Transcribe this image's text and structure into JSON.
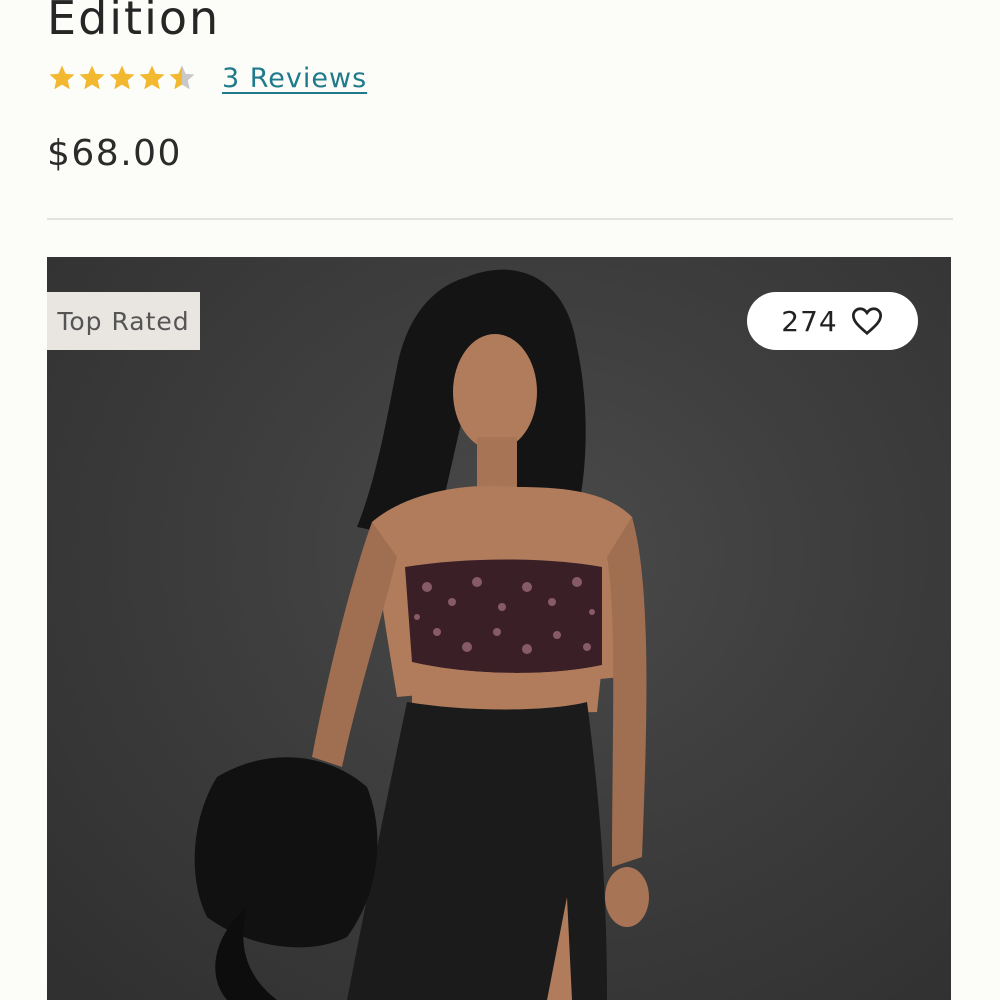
{
  "product": {
    "title": "Edition",
    "rating": {
      "value": 4.5,
      "max": 5
    },
    "reviews_label": "3 Reviews",
    "price": "$68.00"
  },
  "image": {
    "badge": "Top Rated",
    "like_count": "274",
    "icon": "heart-outline-icon"
  },
  "colors": {
    "background": "#fcfcf8",
    "star": "#f2b830",
    "star_empty": "#c8c8c8",
    "link": "#1f7a8c",
    "photo_background": "#3d3d3d"
  }
}
